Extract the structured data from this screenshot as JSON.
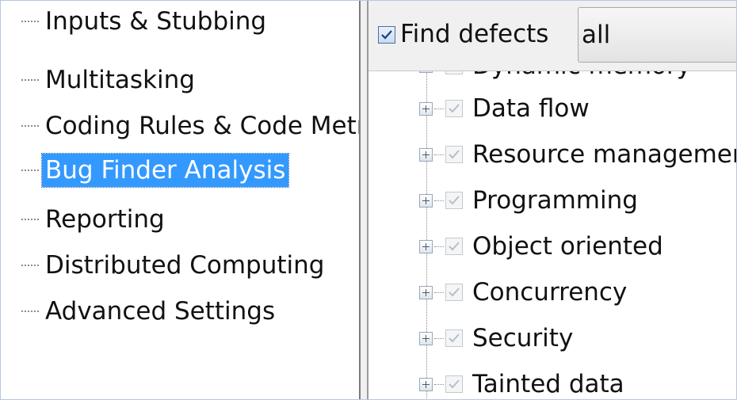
{
  "nav": {
    "items": [
      {
        "label": "Inputs & Stubbing",
        "selected": false
      },
      {
        "label": "Multitasking",
        "selected": false
      },
      {
        "label": "Coding Rules & Code Metrics",
        "selected": false
      },
      {
        "label": "Bug Finder Analysis",
        "selected": true
      },
      {
        "label": "Reporting",
        "selected": false
      },
      {
        "label": "Distributed Computing",
        "selected": false
      },
      {
        "label": "Advanced Settings",
        "selected": false
      }
    ]
  },
  "find_defects": {
    "checked": true,
    "label": "Find defects",
    "selected_value": "all"
  },
  "defect_tree": {
    "items": [
      {
        "label": "Dynamic memory",
        "checked": true,
        "expander": "plus-box-icon"
      },
      {
        "label": "Data flow",
        "checked": true,
        "expander": "plus-box-icon"
      },
      {
        "label": "Resource management",
        "checked": true,
        "expander": "plus-box-icon"
      },
      {
        "label": "Programming",
        "checked": true,
        "expander": "plus-box-icon"
      },
      {
        "label": "Object oriented",
        "checked": true,
        "expander": "plus-box-icon"
      },
      {
        "label": "Concurrency",
        "checked": true,
        "expander": "plus-box-icon"
      },
      {
        "label": "Security",
        "checked": true,
        "expander": "plus-box-icon"
      },
      {
        "label": "Tainted data",
        "checked": true,
        "expander": "plus-box-icon"
      }
    ]
  },
  "colors": {
    "selection_bg": "#3399ff",
    "selection_text": "#ffffff",
    "checkbox_accent": "#4a6fa0"
  }
}
